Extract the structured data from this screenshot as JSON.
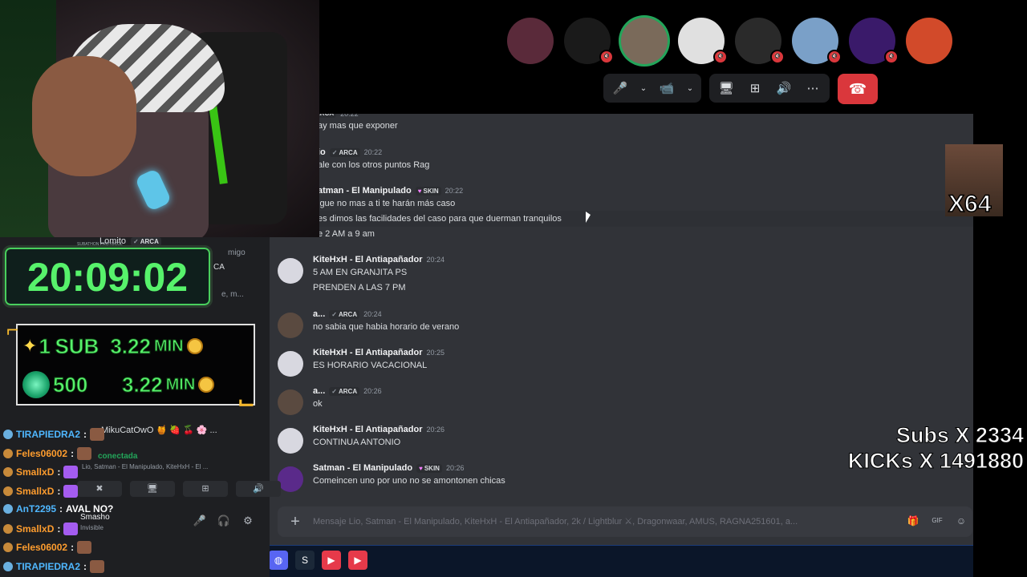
{
  "call": {
    "avatars": [
      {
        "color": "#5a2a3a",
        "muted": false,
        "speaking": false
      },
      {
        "color": "#1a1a1a",
        "muted": true,
        "speaking": false
      },
      {
        "color": "#7a6a5a",
        "muted": false,
        "speaking": true
      },
      {
        "color": "#e0e0e0",
        "muted": true,
        "speaking": false
      },
      {
        "color": "#2a2a2a",
        "muted": true,
        "speaking": false
      },
      {
        "color": "#7aa0c8",
        "muted": true,
        "speaking": false
      },
      {
        "color": "#3a1a6a",
        "muted": true,
        "speaking": false
      },
      {
        "color": "#d24a2a",
        "muted": false,
        "speaking": false
      }
    ],
    "icons": {
      "mic": "🎤",
      "camera": "📹",
      "share": "🖥",
      "activities": "⊞",
      "soundboard": "🔊",
      "more": "⋯",
      "hangup": "☎",
      "chevron": "⌄",
      "muted": "🔇"
    }
  },
  "messages": [
    {
      "line": "ay mas que exponer",
      "name": "",
      "tag": "ARCA",
      "time": "20:22",
      "partial": true
    },
    {
      "name": "io",
      "tag": "ARCA",
      "time": "20:22",
      "lines": [
        "ale con los otros puntos Rag"
      ]
    },
    {
      "name": "atman - El Manipulado",
      "tag": "SKIN",
      "time": "20:22",
      "lines": [
        "igue no mas a ti te harán más caso",
        "es dimos las facilidades del caso para que duerman tranquilos",
        "e 2 AM a 9 am"
      ]
    },
    {
      "name": "KiteHxH - El Antiapañador",
      "time": "20:24",
      "lines": [
        "5 AM EN GRANJITA PS",
        "PRENDEN A LAS 7 PM"
      ],
      "avatar": "#d8d8e0"
    },
    {
      "name": "a...",
      "tag": "ARCA",
      "time": "20:24",
      "lines": [
        "no sabia que habia horario de verano"
      ],
      "avatar": "#5a4a40"
    },
    {
      "name": "KiteHxH - El Antiapañador",
      "time": "20:25",
      "lines": [
        "ES HORARIO VACACIONAL"
      ],
      "avatar": "#d8d8e0"
    },
    {
      "name": "a...",
      "tag": "ARCA",
      "time": "20:26",
      "lines": [
        "ok"
      ],
      "avatar": "#5a4a40"
    },
    {
      "name": "KiteHxH - El Antiapañador",
      "time": "20:26",
      "lines": [
        "CONTINUA ANTONIO"
      ],
      "avatar": "#d8d8e0"
    },
    {
      "name": "Satman - El Manipulado",
      "tag": "SKIN",
      "time": "20:26",
      "lines": [
        "Comeincen uno por uno no se amontonen chicas"
      ],
      "avatar": "#5a2a8a"
    }
  ],
  "composer": {
    "placeholder": "Mensaje Lio, Satman - El Manipulado, KiteHxH - El Antiapañador, 2k / Lightblur ⚔, Dragonwaar, AMUS, RAGNA251601, a...",
    "plus": "+",
    "tools": [
      "🎁",
      "GIF",
      "☺"
    ]
  },
  "timer": {
    "value": "20:09:02",
    "label": "SUBATHON PROTOCOL"
  },
  "rates": [
    {
      "qty": "1",
      "unit": "SUB",
      "time": "3.22",
      "min": "MIN"
    },
    {
      "qty": "500",
      "unit": "",
      "time": "3.22",
      "min": "MIN"
    }
  ],
  "chat": [
    {
      "user": "TIRAPIEDRA2",
      "badge": "blue",
      "emote": "face",
      "text": ""
    },
    {
      "user": "Feles06002",
      "badge": "gold",
      "emote": "face",
      "text": ""
    },
    {
      "user": "SmallxD",
      "badge": "gold",
      "emote": "cat",
      "text": ""
    },
    {
      "user": "SmallxD",
      "badge": "gold",
      "emote": "cat",
      "text": ""
    },
    {
      "user": "AnT2295",
      "badge": "blue",
      "emote": "",
      "text": "AVAL NO?"
    },
    {
      "user": "SmallxD",
      "badge": "gold",
      "emote": "cat",
      "text": ""
    },
    {
      "user": "Feles06002",
      "badge": "gold",
      "emote": "face",
      "text": ""
    },
    {
      "user": "TIRAPIEDRA2",
      "badge": "blue",
      "emote": "face",
      "text": ""
    }
  ],
  "members": {
    "top_name": "Lomito",
    "top_tag": "ARCA",
    "partial_right": [
      "migo",
      "CA",
      "e, m..."
    ],
    "bottom_name": "MikuCatOwO",
    "bottom_emoji": "🍯 🍓 🍒 🌸 ..."
  },
  "voice": {
    "status": "conectada",
    "channel": "Lio, Satman - El Manipulado, KiteHxH - El ...",
    "actions": [
      "✖",
      "🖥",
      "⊞",
      "🔊"
    ]
  },
  "user": {
    "name": "Smasho",
    "status": "Invisible",
    "icons": [
      "🎤",
      "🎧",
      "⚙"
    ]
  },
  "overlay": {
    "emote_count": "X64",
    "subs_label": "Subs X",
    "subs_value": "2334",
    "kicks_label": "KICKs X",
    "kicks_value": "1491880"
  },
  "taskbar": [
    {
      "icon": "◆",
      "color": "#c23a3a"
    },
    {
      "icon": "✕",
      "color": "#2b2b2b"
    },
    {
      "icon": "▶",
      "color": "#1a3a1a"
    },
    {
      "icon": "◎",
      "color": "#3a3a3a"
    },
    {
      "icon": "▣",
      "color": "#2a4a7a"
    },
    {
      "icon": "B",
      "color": "#e0592a"
    },
    {
      "icon": "●",
      "color": "#3a8a3a"
    },
    {
      "icon": "◍",
      "color": "#5865f2"
    },
    {
      "icon": "S",
      "color": "#1b2838"
    },
    {
      "icon": "▶",
      "color": "#e63a4a"
    },
    {
      "icon": "▶",
      "color": "#e63a4a"
    }
  ]
}
